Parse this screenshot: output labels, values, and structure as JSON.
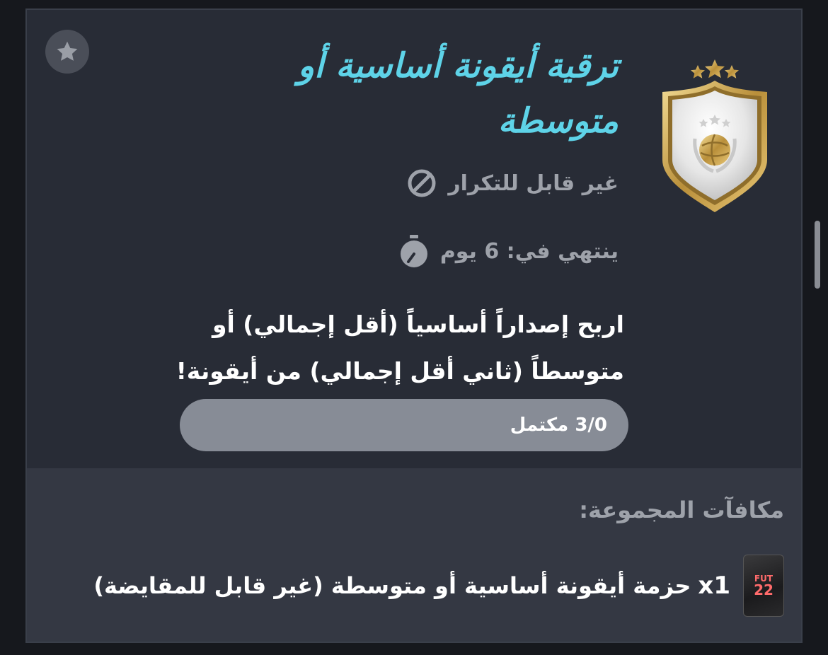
{
  "objective": {
    "title": "ترقية أيقونة أساسية أو متوسطة",
    "repeat_status": "غير قابل للتكرار",
    "expires": "ينتهي في: 6 يوم",
    "description": "اربح إصداراً أساسياً (أقل إجمالي) أو متوسطاً (ثاني أقل إجمالي) من أيقونة!",
    "progress": {
      "label": "3/0 مكتمل",
      "completed": 0,
      "total": 3
    }
  },
  "rewards": {
    "title": "مكافآت المجموعة:",
    "items": [
      {
        "quantity": "x1",
        "name": "حزمة أيقونة أساسية أو متوسطة (غير قابل للمقايضة)",
        "pack_brand": "FUT",
        "pack_year": "22"
      }
    ]
  },
  "colors": {
    "accent": "#5ed3e8",
    "card_bg": "#282c36",
    "rewards_bg": "#343843",
    "muted_text": "#9ea2aa",
    "progress_track": "#878c96",
    "badge_gold": "#d9b65e"
  },
  "icons": {
    "favorite": "star-icon",
    "repeat": "no-repeat-icon",
    "timer": "stopwatch-icon",
    "badge": "icon-shield-badge"
  }
}
